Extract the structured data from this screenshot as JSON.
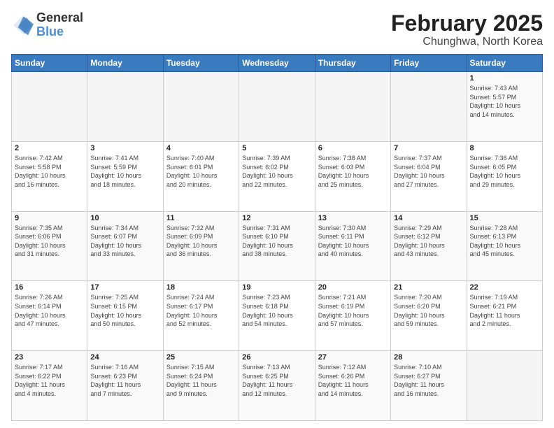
{
  "logo": {
    "line1": "General",
    "line2": "Blue"
  },
  "title": "February 2025",
  "subtitle": "Chunghwa, North Korea",
  "days_of_week": [
    "Sunday",
    "Monday",
    "Tuesday",
    "Wednesday",
    "Thursday",
    "Friday",
    "Saturday"
  ],
  "weeks": [
    [
      {
        "day": "",
        "info": ""
      },
      {
        "day": "",
        "info": ""
      },
      {
        "day": "",
        "info": ""
      },
      {
        "day": "",
        "info": ""
      },
      {
        "day": "",
        "info": ""
      },
      {
        "day": "",
        "info": ""
      },
      {
        "day": "1",
        "info": "Sunrise: 7:43 AM\nSunset: 5:57 PM\nDaylight: 10 hours\nand 14 minutes."
      }
    ],
    [
      {
        "day": "2",
        "info": "Sunrise: 7:42 AM\nSunset: 5:58 PM\nDaylight: 10 hours\nand 16 minutes."
      },
      {
        "day": "3",
        "info": "Sunrise: 7:41 AM\nSunset: 5:59 PM\nDaylight: 10 hours\nand 18 minutes."
      },
      {
        "day": "4",
        "info": "Sunrise: 7:40 AM\nSunset: 6:01 PM\nDaylight: 10 hours\nand 20 minutes."
      },
      {
        "day": "5",
        "info": "Sunrise: 7:39 AM\nSunset: 6:02 PM\nDaylight: 10 hours\nand 22 minutes."
      },
      {
        "day": "6",
        "info": "Sunrise: 7:38 AM\nSunset: 6:03 PM\nDaylight: 10 hours\nand 25 minutes."
      },
      {
        "day": "7",
        "info": "Sunrise: 7:37 AM\nSunset: 6:04 PM\nDaylight: 10 hours\nand 27 minutes."
      },
      {
        "day": "8",
        "info": "Sunrise: 7:36 AM\nSunset: 6:05 PM\nDaylight: 10 hours\nand 29 minutes."
      }
    ],
    [
      {
        "day": "9",
        "info": "Sunrise: 7:35 AM\nSunset: 6:06 PM\nDaylight: 10 hours\nand 31 minutes."
      },
      {
        "day": "10",
        "info": "Sunrise: 7:34 AM\nSunset: 6:07 PM\nDaylight: 10 hours\nand 33 minutes."
      },
      {
        "day": "11",
        "info": "Sunrise: 7:32 AM\nSunset: 6:09 PM\nDaylight: 10 hours\nand 36 minutes."
      },
      {
        "day": "12",
        "info": "Sunrise: 7:31 AM\nSunset: 6:10 PM\nDaylight: 10 hours\nand 38 minutes."
      },
      {
        "day": "13",
        "info": "Sunrise: 7:30 AM\nSunset: 6:11 PM\nDaylight: 10 hours\nand 40 minutes."
      },
      {
        "day": "14",
        "info": "Sunrise: 7:29 AM\nSunset: 6:12 PM\nDaylight: 10 hours\nand 43 minutes."
      },
      {
        "day": "15",
        "info": "Sunrise: 7:28 AM\nSunset: 6:13 PM\nDaylight: 10 hours\nand 45 minutes."
      }
    ],
    [
      {
        "day": "16",
        "info": "Sunrise: 7:26 AM\nSunset: 6:14 PM\nDaylight: 10 hours\nand 47 minutes."
      },
      {
        "day": "17",
        "info": "Sunrise: 7:25 AM\nSunset: 6:15 PM\nDaylight: 10 hours\nand 50 minutes."
      },
      {
        "day": "18",
        "info": "Sunrise: 7:24 AM\nSunset: 6:17 PM\nDaylight: 10 hours\nand 52 minutes."
      },
      {
        "day": "19",
        "info": "Sunrise: 7:23 AM\nSunset: 6:18 PM\nDaylight: 10 hours\nand 54 minutes."
      },
      {
        "day": "20",
        "info": "Sunrise: 7:21 AM\nSunset: 6:19 PM\nDaylight: 10 hours\nand 57 minutes."
      },
      {
        "day": "21",
        "info": "Sunrise: 7:20 AM\nSunset: 6:20 PM\nDaylight: 10 hours\nand 59 minutes."
      },
      {
        "day": "22",
        "info": "Sunrise: 7:19 AM\nSunset: 6:21 PM\nDaylight: 11 hours\nand 2 minutes."
      }
    ],
    [
      {
        "day": "23",
        "info": "Sunrise: 7:17 AM\nSunset: 6:22 PM\nDaylight: 11 hours\nand 4 minutes."
      },
      {
        "day": "24",
        "info": "Sunrise: 7:16 AM\nSunset: 6:23 PM\nDaylight: 11 hours\nand 7 minutes."
      },
      {
        "day": "25",
        "info": "Sunrise: 7:15 AM\nSunset: 6:24 PM\nDaylight: 11 hours\nand 9 minutes."
      },
      {
        "day": "26",
        "info": "Sunrise: 7:13 AM\nSunset: 6:25 PM\nDaylight: 11 hours\nand 12 minutes."
      },
      {
        "day": "27",
        "info": "Sunrise: 7:12 AM\nSunset: 6:26 PM\nDaylight: 11 hours\nand 14 minutes."
      },
      {
        "day": "28",
        "info": "Sunrise: 7:10 AM\nSunset: 6:27 PM\nDaylight: 11 hours\nand 16 minutes."
      },
      {
        "day": "",
        "info": ""
      }
    ]
  ]
}
